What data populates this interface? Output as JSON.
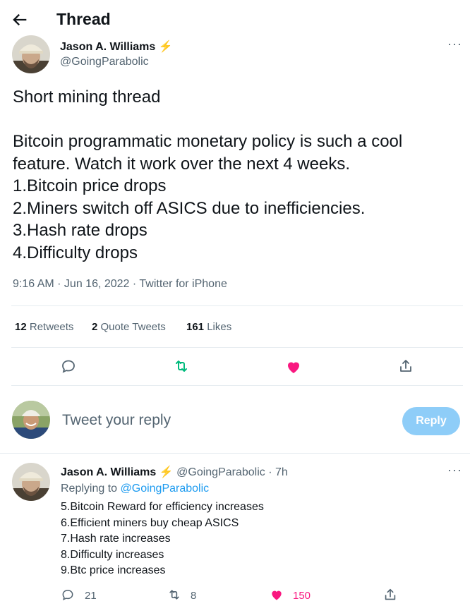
{
  "header": {
    "title": "Thread",
    "back_icon": "arrow-left-icon"
  },
  "main_tweet": {
    "author_name": "Jason A. Williams",
    "author_badge": "⚡",
    "author_handle": "@GoingParabolic",
    "text": "Short mining thread\n\nBitcoin programmatic monetary policy is such a cool feature. Watch it work over the next 4 weeks.\n1.Bitcoin price drops\n2.Miners switch off ASICS due to inefficiencies.\n3.Hash rate drops\n4.Difficulty drops",
    "timestamp": "9:16 AM · Jun 16, 2022 · Twitter for iPhone",
    "stats": {
      "retweets_count": "12",
      "retweets_label": "Retweets",
      "quotes_count": "2",
      "quotes_label": "Quote Tweets",
      "likes_count": "161",
      "likes_label": "Likes"
    }
  },
  "composer": {
    "placeholder": "Tweet your reply",
    "button_label": "Reply"
  },
  "reply_tweet": {
    "author_name": "Jason A. Williams",
    "author_badge": "⚡",
    "author_handle": "@GoingParabolic",
    "time": "· 7h",
    "replying_prefix": "Replying to",
    "replying_to": "@GoingParabolic",
    "text": "5.Bitcoin Reward for efficiency increases\n6.Efficient miners buy cheap ASICS\n7.Hash rate increases\n8.Difficulty increases\n9.Btc price increases",
    "reply_count": "21",
    "retweet_count": "8",
    "like_count": "150"
  },
  "colors": {
    "accent": "#1d9bf0",
    "like": "#f91880",
    "retweet": "#00ba7c",
    "muted": "#536471"
  }
}
